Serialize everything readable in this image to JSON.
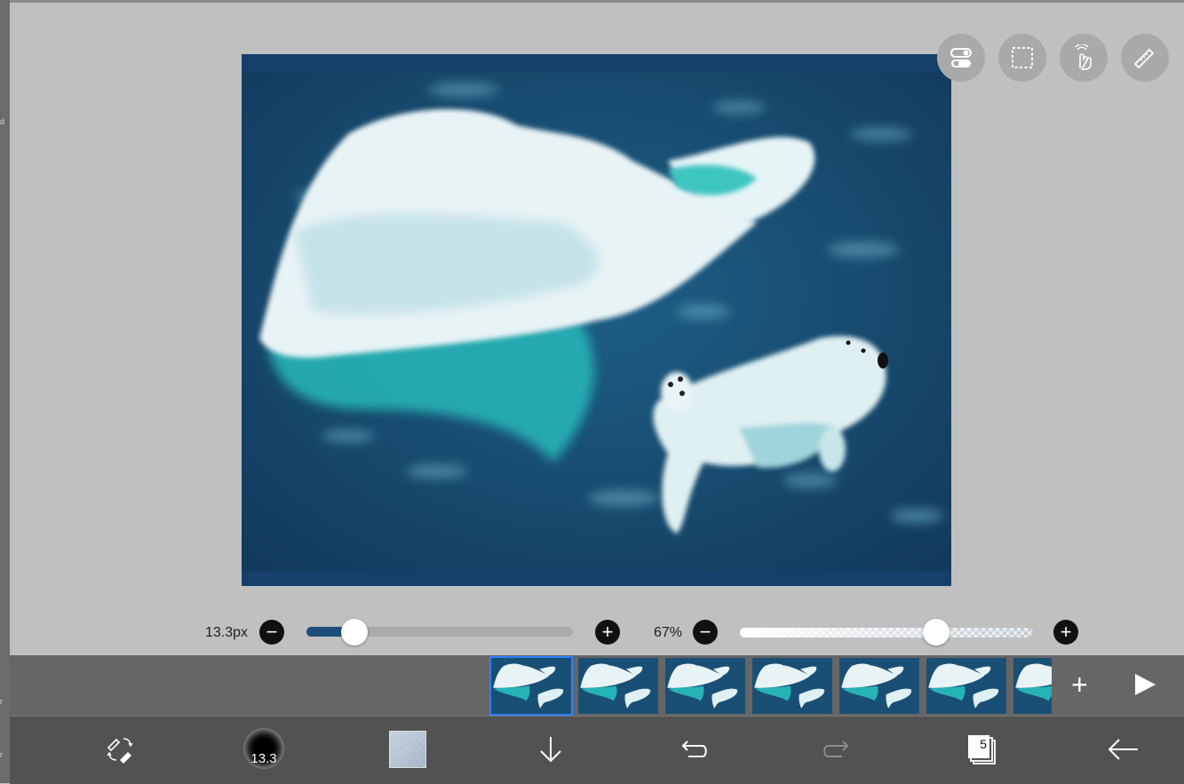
{
  "brush": {
    "size_label": "13.3px",
    "size_fraction": 0.18,
    "preview_label": "13.3",
    "opacity_label": "67%",
    "opacity_fraction": 0.67
  },
  "timeline": {
    "frame_count_visible": 7,
    "selected_frame": 1,
    "add_label": "+"
  },
  "toolbar": {
    "layer_count": "5"
  },
  "left_edge": {
    "labels": [
      "d",
      "r",
      "r"
    ]
  },
  "colors": {
    "canvas_bg": "#17456a",
    "accent": "#2f7fff",
    "timeline_bg": "#666666",
    "toolbar_bg": "#525252"
  },
  "icons": [
    "toggle-icon",
    "selection-icon",
    "gesture-icon",
    "ruler-icon",
    "pen-eraser-swap-icon",
    "download-arrow-icon",
    "undo-icon",
    "redo-icon",
    "layers-icon",
    "back-arrow-icon",
    "play-icon",
    "add-frame-icon"
  ]
}
